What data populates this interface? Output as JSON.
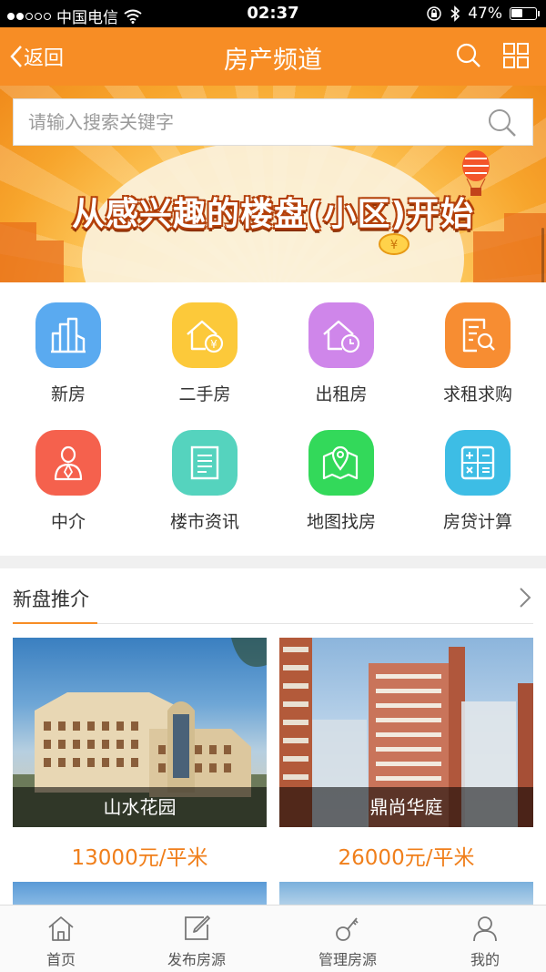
{
  "status_bar": {
    "carrier": "中国电信",
    "time": "02:37",
    "battery": "47%",
    "battery_level": 0.47,
    "signal_bars": 2
  },
  "header": {
    "back_label": "返回",
    "title": "房产频道",
    "background": "#f78d25"
  },
  "search": {
    "placeholder": "请输入搜索关键字"
  },
  "banner": {
    "slogan": "从感兴趣的楼盘(小区)开始"
  },
  "categories": [
    {
      "label": "新房",
      "icon": "buildings-icon",
      "color": "#5aaaf0"
    },
    {
      "label": "二手房",
      "icon": "house-yuan-icon",
      "color": "#fcc93a"
    },
    {
      "label": "出租房",
      "icon": "house-clock-icon",
      "color": "#cf86ea"
    },
    {
      "label": "求租求购",
      "icon": "document-search-icon",
      "color": "#f78d32"
    },
    {
      "label": "中介",
      "icon": "agent-person-icon",
      "color": "#f5614d"
    },
    {
      "label": "楼市资讯",
      "icon": "news-document-icon",
      "color": "#55d3be"
    },
    {
      "label": "地图找房",
      "icon": "map-pin-icon",
      "color": "#33d95a"
    },
    {
      "label": "房贷计算",
      "icon": "calculator-icon",
      "color": "#3dbde5"
    }
  ],
  "new_listings": {
    "title": "新盘推介",
    "accent": "#f78d25",
    "items": [
      {
        "name": "山水花园",
        "price": "13000元/平米"
      },
      {
        "name": "鼎尚华庭",
        "price": "26000元/平米"
      }
    ]
  },
  "tabbar": {
    "items": [
      {
        "label": "首页",
        "icon": "home-icon"
      },
      {
        "label": "发布房源",
        "icon": "edit-icon"
      },
      {
        "label": "管理房源",
        "icon": "key-icon"
      },
      {
        "label": "我的",
        "icon": "user-icon"
      }
    ]
  }
}
